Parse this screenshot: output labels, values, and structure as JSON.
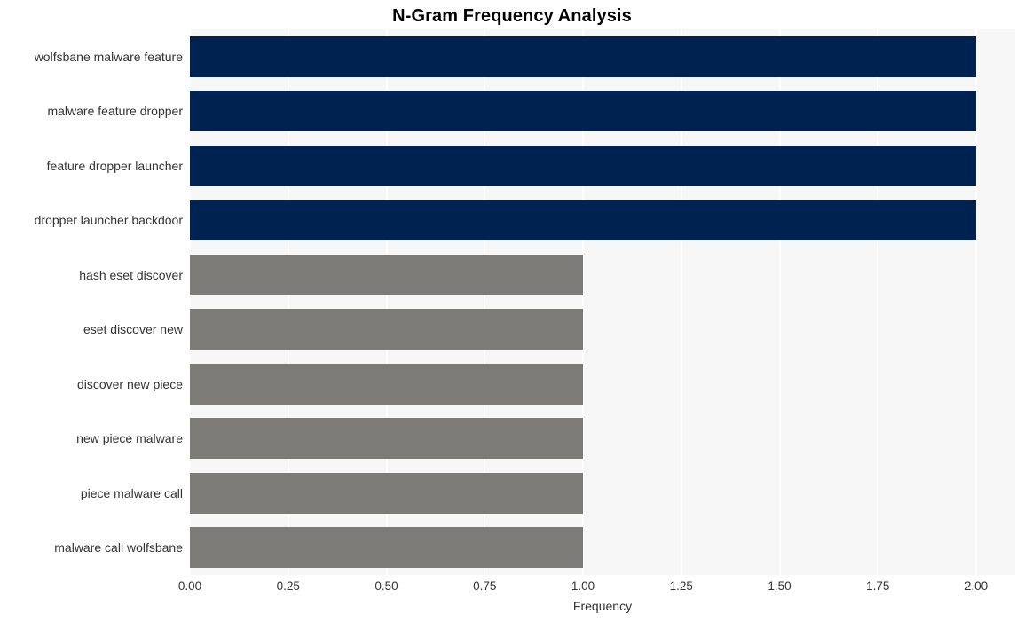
{
  "chart_data": {
    "type": "bar",
    "orientation": "horizontal",
    "title": "N-Gram Frequency Analysis",
    "xlabel": "Frequency",
    "ylabel": "",
    "categories": [
      "wolfsbane malware feature",
      "malware feature dropper",
      "feature dropper launcher",
      "dropper launcher backdoor",
      "hash eset discover",
      "eset discover new",
      "discover new piece",
      "new piece malware",
      "piece malware call",
      "malware call wolfsbane"
    ],
    "values": [
      2,
      2,
      2,
      2,
      1,
      1,
      1,
      1,
      1,
      1
    ],
    "bar_colors": [
      "#002250",
      "#002250",
      "#002250",
      "#002250",
      "#7c7b78",
      "#7c7b78",
      "#7c7b78",
      "#7c7b78",
      "#7c7b78",
      "#7c7b78"
    ],
    "xlim": [
      0,
      2
    ],
    "xticks": [
      0,
      0.25,
      0.5,
      0.75,
      1,
      1.25,
      1.5,
      1.75,
      2
    ],
    "xtick_labels": [
      "0.00",
      "0.25",
      "0.50",
      "0.75",
      "1.00",
      "1.25",
      "1.50",
      "1.75",
      "2.00"
    ],
    "grid": true,
    "grid_axis": "x",
    "grid_color": "#ffffff",
    "legend": false,
    "plot_background": "#f7f7f7",
    "figure_background": "#ffffff",
    "title_color": "#000000",
    "tick_label_color": "#333333",
    "highlight_color": "#002250",
    "base_color": "#7c7b78"
  }
}
